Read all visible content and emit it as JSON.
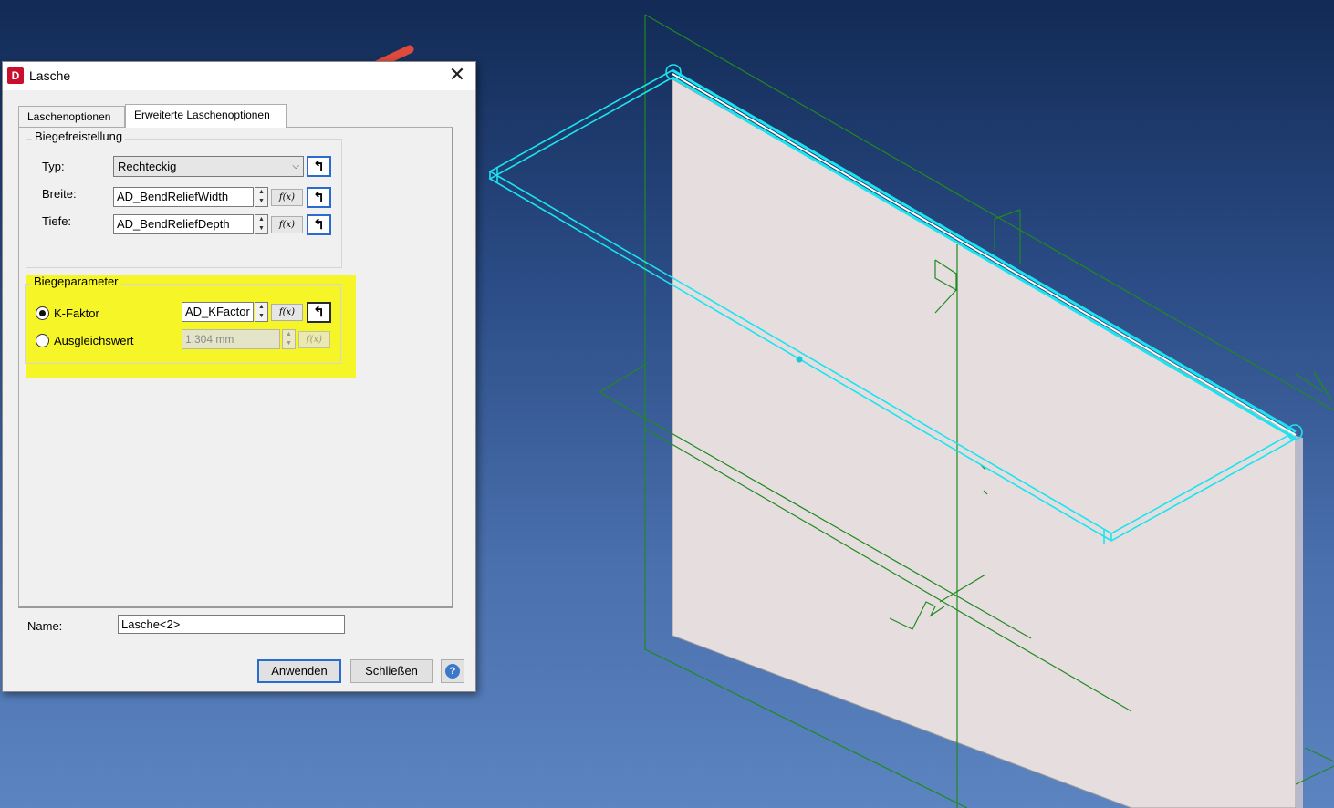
{
  "dialog": {
    "app_icon_letter": "D",
    "title": "Lasche",
    "close_glyph": "✕"
  },
  "tabs": [
    {
      "label": "Laschenoptionen",
      "active": false
    },
    {
      "label": "Erweiterte Laschenoptionen",
      "active": true
    }
  ],
  "bend_relief": {
    "group_title": "Biegefreistellung",
    "type_label": "Typ:",
    "type_value": "Rechteckig",
    "width_label": "Breite:",
    "width_value": "AD_BendReliefWidth",
    "depth_label": "Tiefe:",
    "depth_value": "AD_BendReliefDepth"
  },
  "bend_params": {
    "group_title": "Biegeparameter",
    "kfactor_label": "K-Faktor",
    "kfactor_value": "AD_KFactor",
    "kfactor_selected": true,
    "allowance_label": "Ausgleichswert",
    "allowance_value": "1,304 mm",
    "allowance_selected": false,
    "highlight_color": "#f5f527"
  },
  "fx_label": "f(x)",
  "pick_glyph": "↰",
  "spin_up": "▲",
  "spin_down": "▼",
  "name_label": "Name:",
  "name_value": "Lasche<2>",
  "buttons": {
    "apply": "Anwenden",
    "close": "Schließen",
    "help": "?"
  },
  "colors": {
    "accent": "#2a6bd0",
    "annotation_arrow": "#e04a3c",
    "edge_highlight": "#19e4f0",
    "sketch_lines": "#1f8a1f",
    "part_face": "#e6dede"
  }
}
